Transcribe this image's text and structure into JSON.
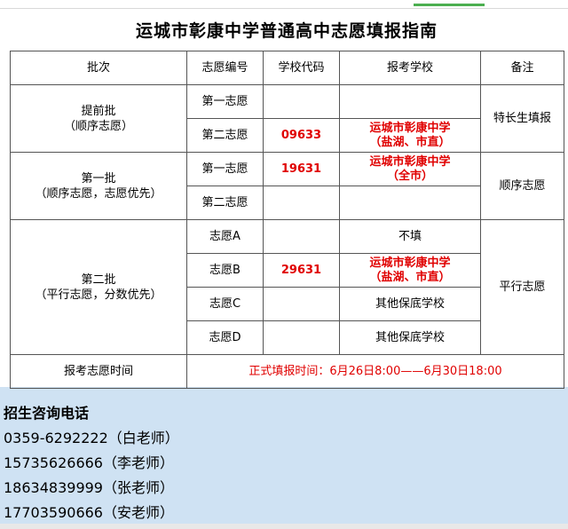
{
  "title": "运城市彰康中学普通高中志愿填报指南",
  "headers": [
    "批次",
    "志愿编号",
    "学校代码",
    "报考学校",
    "备注"
  ],
  "batches": {
    "early": {
      "name": "提前批",
      "note": "（顺序志愿）",
      "remark": "特长生填报"
    },
    "first": {
      "name": "第一批",
      "note": "（顺序志愿，志愿优先）",
      "remark": "顺序志愿"
    },
    "second": {
      "name": "第二批",
      "note": "（平行志愿，分数优先）",
      "remark": "平行志愿"
    }
  },
  "rows": [
    {
      "choice": "第一志愿",
      "code": "",
      "school_line1": "",
      "school_line2": ""
    },
    {
      "choice": "第二志愿",
      "code": "09633",
      "school_line1": "运城市彰康中学",
      "school_line2": "（盐湖、市直）"
    },
    {
      "choice": "第一志愿",
      "code": "19631",
      "school_line1": "运城市彰康中学",
      "school_line2": "（全市）"
    },
    {
      "choice": "第二志愿",
      "code": "",
      "school_line1": "",
      "school_line2": ""
    },
    {
      "choice": "志愿A",
      "code": "",
      "school_line1": "不填",
      "school_line2": ""
    },
    {
      "choice": "志愿B",
      "code": "29631",
      "school_line1": "运城市彰康中学",
      "school_line2": "（盐湖、市直）"
    },
    {
      "choice": "志愿C",
      "code": "",
      "school_line1": "其他保底学校",
      "school_line2": ""
    },
    {
      "choice": "志愿D",
      "code": "",
      "school_line1": "其他保底学校",
      "school_line2": ""
    }
  ],
  "time_row": {
    "label": "报考志愿时间",
    "value": "正式填报时间：6月26日8:00——6月30日18:00"
  },
  "contact": {
    "heading": "招生咨询电话",
    "phones": [
      "0359-6292222（白老师）",
      "15735626666（李老师）",
      "18634839999（张老师）",
      "17703590666（安老师）"
    ]
  },
  "colors": {
    "accent_red": "#e00000",
    "panel_blue": "#cfe2f3"
  }
}
